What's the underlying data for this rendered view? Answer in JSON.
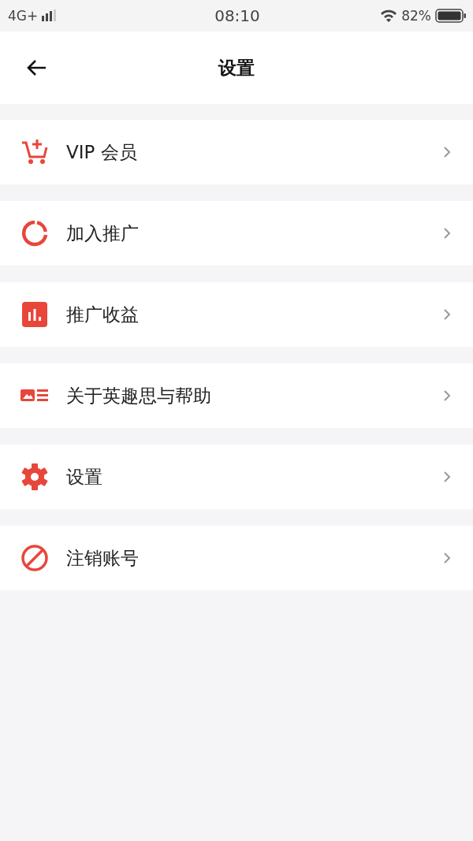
{
  "status_bar": {
    "network": "4G+",
    "time": "08:10",
    "battery": "82%"
  },
  "header": {
    "title": "设置"
  },
  "menu": [
    {
      "kind": "cart",
      "label": "VIP 会员"
    },
    {
      "kind": "ring",
      "label": "加入推广"
    },
    {
      "kind": "chart",
      "label": "推广收益"
    },
    {
      "kind": "card",
      "label": "关于英趣思与帮助"
    },
    {
      "kind": "gear",
      "label": "设置"
    },
    {
      "kind": "ban",
      "label": "注销账号"
    }
  ]
}
